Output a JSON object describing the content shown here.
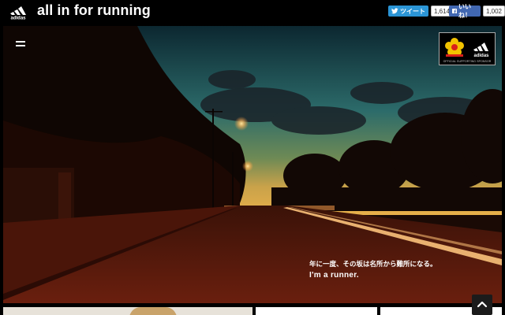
{
  "header": {
    "brand_logo_text": "adidas",
    "title": "all in for running"
  },
  "social": {
    "tweet": {
      "label": "ツイート",
      "count": "1,614"
    },
    "like": {
      "label": "いいね！",
      "count": "1,002"
    }
  },
  "hero": {
    "sponsor_caption": "OFFICIAL SUPPORTING SPONSOR",
    "sponsor_logo_text": "adidas",
    "tagline_jp": "年に一度、その坂は名所から難所になる。",
    "tagline_en": "I'm a runner."
  },
  "colors": {
    "tweet_button": "#2b95d6",
    "like_button": "#4167b1",
    "sky_top": "#15363f",
    "road": "#5a1a0c"
  }
}
